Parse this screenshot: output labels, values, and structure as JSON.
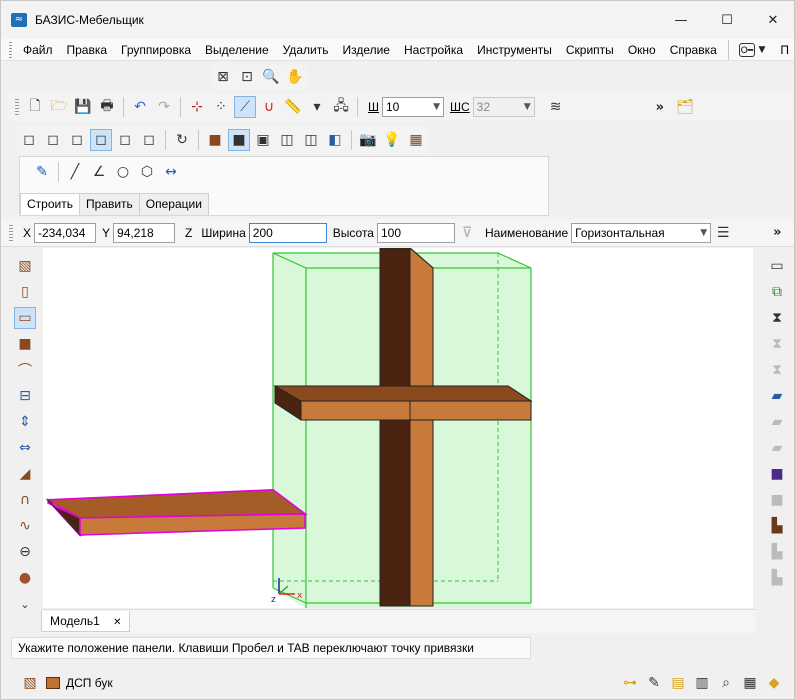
{
  "window": {
    "title": "БАЗИС-Мебельщик",
    "minimize_glyph": "—",
    "maximize_glyph": "☐",
    "close_glyph": "✕"
  },
  "menu": {
    "items": [
      "Файл",
      "Правка",
      "Группировка",
      "Выделение",
      "Удалить",
      "Изделие",
      "Настройка",
      "Инструменты",
      "Скрипты",
      "Окно",
      "Справка"
    ],
    "overflow_label": "П"
  },
  "toolbar": {
    "chevron": "»",
    "width_short_label": "Ш",
    "width_value": "10",
    "layers_label": "ШС",
    "layers_value": "32"
  },
  "tabs": {
    "items": [
      "Строить",
      "Править",
      "Операции"
    ],
    "active": "Строить"
  },
  "coords": {
    "x_label": "X",
    "x_value": "-234,034",
    "y_label": "Y",
    "y_value": "94,218",
    "z_label": "Z",
    "width_label": "Ширина",
    "width_value": "200",
    "height_label": "Высота",
    "height_value": "100",
    "name_label": "Наименование",
    "name_value": "Горизонтальная"
  },
  "viewport": {
    "axis_x_label": "x",
    "axis_z_label": "z"
  },
  "document": {
    "tab_name": "Модель1",
    "close_glyph": "✕"
  },
  "status": {
    "message": "Укажите положение панели. Клавиши Пробел и TAB переключают точку привязки"
  },
  "material": {
    "name": "ДСП бук"
  },
  "colors": {
    "wood_light": "#c77a3a",
    "wood_dark": "#4a2410",
    "selection_green": "#9be59b",
    "highlight_magenta": "#e000e0"
  },
  "icons": {
    "left_toolbar": [
      "panel-icon",
      "vertical-panel-icon",
      "horizontal-panel-icon",
      "frontal-panel-icon",
      "bent-panel-icon",
      "shelf-fill-icon",
      "vertical-divide-icon",
      "horizontal-divide-icon",
      "profile-icon",
      "arch-icon",
      "curve-icon",
      "drill-icon",
      "sphere-icon"
    ],
    "right_toolbar": [
      "view-icon",
      "copy-icon",
      "screw-icon",
      "screw-arrow-icon",
      "screw-x-icon",
      "add-panel-icon",
      "panel-arrow-icon",
      "panel-x-icon",
      "cube-add-icon",
      "cube-x-icon",
      "box-icon",
      "box-arrow-icon",
      "box-x-icon"
    ]
  }
}
